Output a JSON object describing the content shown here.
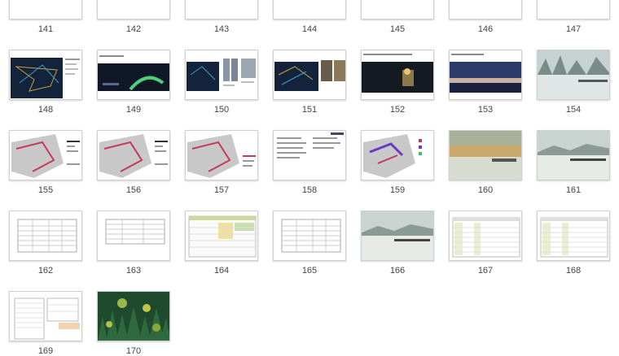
{
  "pages": [
    {
      "label": "141",
      "kind": "photo-strip"
    },
    {
      "label": "142",
      "kind": "blank"
    },
    {
      "label": "143",
      "kind": "night-city"
    },
    {
      "label": "144",
      "kind": "night-lights"
    },
    {
      "label": "145",
      "kind": "dark-map"
    },
    {
      "label": "146",
      "kind": "circles"
    },
    {
      "label": "147",
      "kind": "dark-banner"
    },
    {
      "label": "148",
      "kind": "dark-map-text"
    },
    {
      "label": "149",
      "kind": "night-green"
    },
    {
      "label": "150",
      "kind": "map-towers"
    },
    {
      "label": "151",
      "kind": "map-photo"
    },
    {
      "label": "152",
      "kind": "night-scene"
    },
    {
      "label": "153",
      "kind": "night-sky"
    },
    {
      "label": "154",
      "kind": "forest-mist"
    },
    {
      "label": "155",
      "kind": "plan-map"
    },
    {
      "label": "156",
      "kind": "plan-map"
    },
    {
      "label": "157",
      "kind": "plan-map-side"
    },
    {
      "label": "158",
      "kind": "text-doc"
    },
    {
      "label": "159",
      "kind": "plan-map-color"
    },
    {
      "label": "160",
      "kind": "meadow"
    },
    {
      "label": "161",
      "kind": "frost-field"
    },
    {
      "label": "162",
      "kind": "table-doc"
    },
    {
      "label": "163",
      "kind": "table-small"
    },
    {
      "label": "164",
      "kind": "table-color"
    },
    {
      "label": "165",
      "kind": "table-doc"
    },
    {
      "label": "166",
      "kind": "frost-field"
    },
    {
      "label": "167",
      "kind": "spreadsheet"
    },
    {
      "label": "168",
      "kind": "spreadsheet"
    },
    {
      "label": "169",
      "kind": "spreadsheet-tall"
    },
    {
      "label": "170",
      "kind": "forest-photo"
    }
  ]
}
